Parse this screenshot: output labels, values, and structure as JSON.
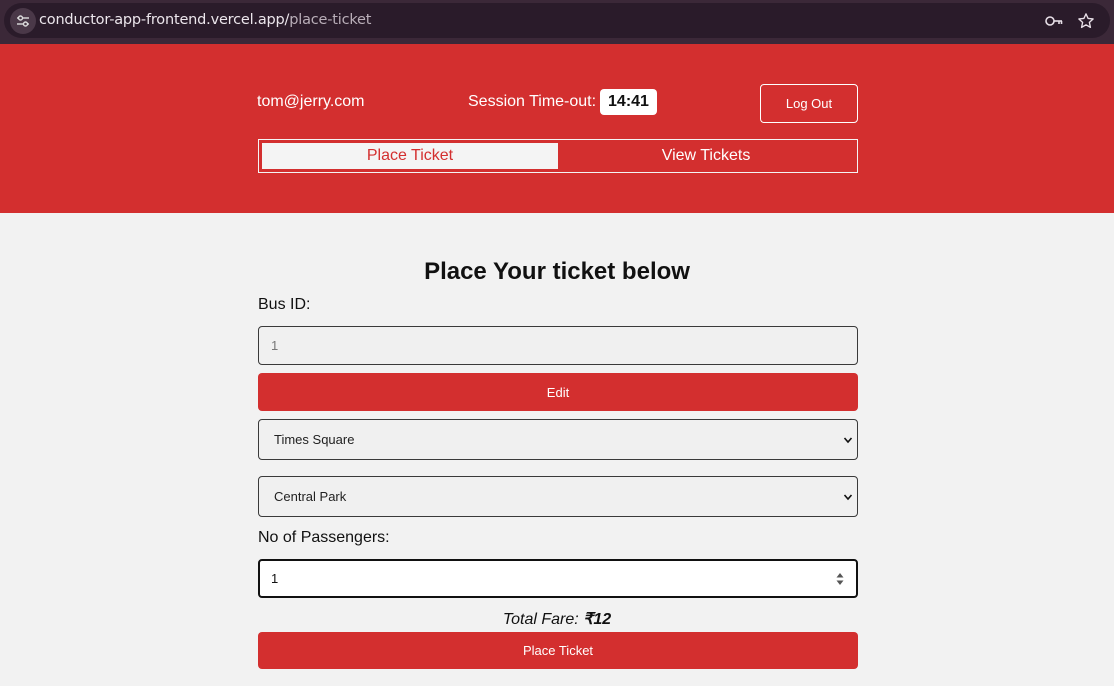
{
  "browser": {
    "url_domain": "conductor-app-frontend.vercel.app/",
    "url_path": "place-ticket"
  },
  "header": {
    "email": "tom@jerry.com",
    "session_label": "Session Time-out:",
    "timer": "14:41",
    "logout_label": "Log Out",
    "tabs": [
      {
        "label": "Place Ticket",
        "active": true
      },
      {
        "label": "View Tickets",
        "active": false
      }
    ]
  },
  "form": {
    "title": "Place Your ticket below",
    "bus_id_label": "Bus ID:",
    "bus_id_value": "1",
    "edit_label": "Edit",
    "from_stop": "Times Square",
    "to_stop": "Central Park",
    "passengers_label": "No of Passengers:",
    "passengers_value": "1",
    "fare_label": "Total Fare:",
    "fare_value": "₹12",
    "submit_label": "Place Ticket"
  },
  "colors": {
    "primary": "#d32f2f",
    "background": "#f2f2f2",
    "chrome": "#3b2838"
  }
}
